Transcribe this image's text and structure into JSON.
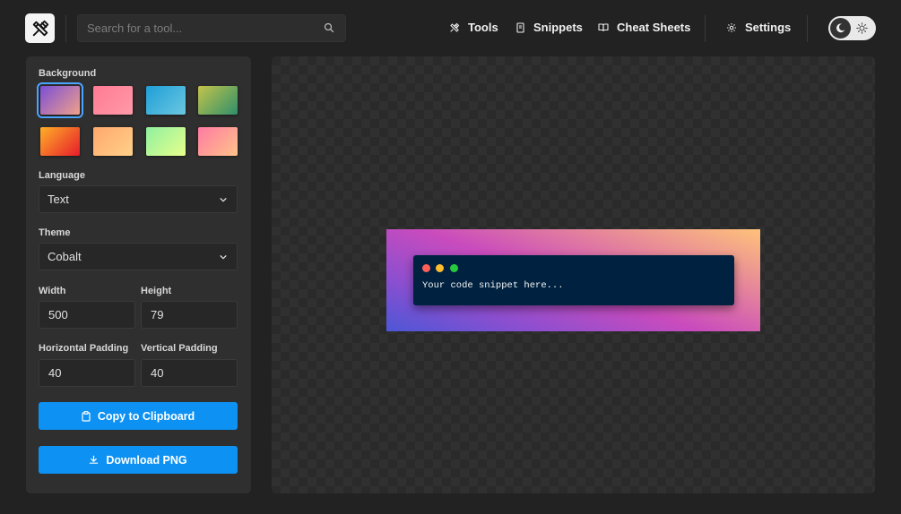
{
  "header": {
    "search": {
      "placeholder": "Search for a tool..."
    },
    "nav": [
      {
        "label": "Tools",
        "icon": "tools-icon"
      },
      {
        "label": "Snippets",
        "icon": "snippets-icon"
      },
      {
        "label": "Cheat Sheets",
        "icon": "book-icon"
      },
      {
        "label": "Settings",
        "icon": "gear-icon"
      }
    ]
  },
  "sidebar": {
    "background_label": "Background",
    "backgrounds": [
      {
        "from": "#7b4fd6",
        "to": "#f0a08a",
        "selected": true
      },
      {
        "from": "#ff7b93",
        "to": "#ff9aa8",
        "selected": false
      },
      {
        "from": "#1e9fd8",
        "to": "#6cc7e0",
        "selected": false
      },
      {
        "from": "#c4c44b",
        "to": "#2e8f6a",
        "selected": false
      },
      {
        "from": "#ffb028",
        "to": "#e61c2a",
        "selected": false
      },
      {
        "from": "#ffa86b",
        "to": "#ffd08a",
        "selected": false
      },
      {
        "from": "#8ff0a0",
        "to": "#e7ff8c",
        "selected": false
      },
      {
        "from": "#ff7aa2",
        "to": "#ffc38a",
        "selected": false
      }
    ],
    "language_label": "Language",
    "language_value": "Text",
    "theme_label": "Theme",
    "theme_value": "Cobalt",
    "width_label": "Width",
    "width_value": "500",
    "height_label": "Height",
    "height_value": "79",
    "hpad_label": "Horizontal Padding",
    "hpad_value": "40",
    "vpad_label": "Vertical Padding",
    "vpad_value": "40",
    "copy_label": "Copy to Clipboard",
    "download_label": "Download PNG"
  },
  "preview": {
    "code": "Your code snippet here...",
    "dots": [
      "#ff5f56",
      "#ffbd2e",
      "#27c93f"
    ]
  }
}
